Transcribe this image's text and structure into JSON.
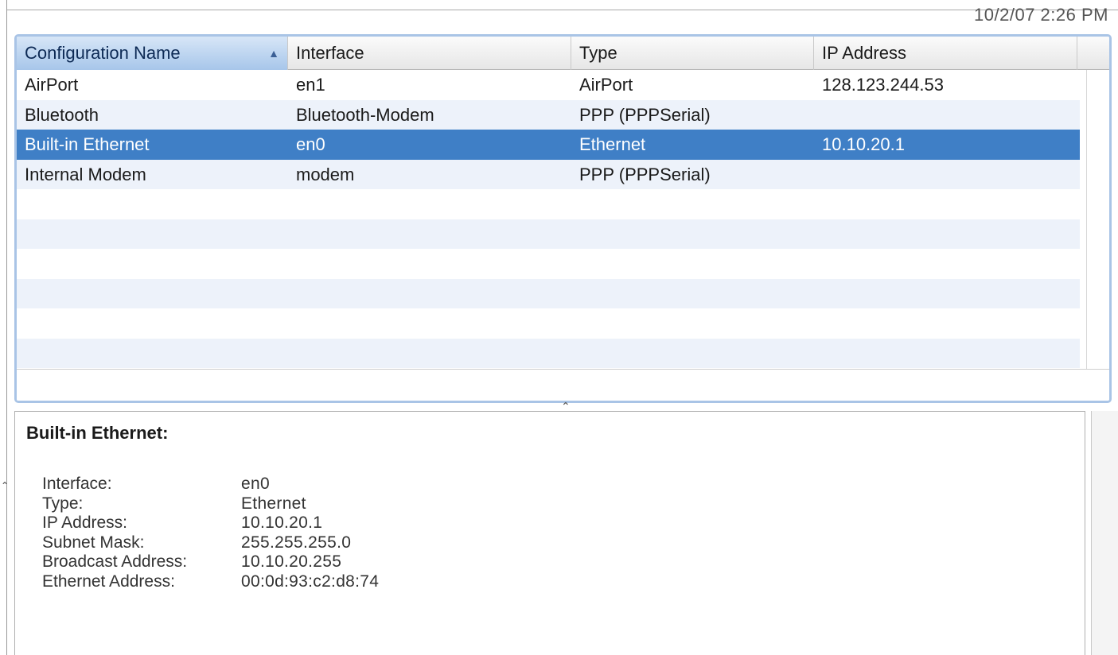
{
  "timestamp": "10/2/07 2:26 PM",
  "table": {
    "columns": [
      "Configuration Name",
      "Interface",
      "Type",
      "IP Address"
    ],
    "sort_indicator": "▲",
    "rows": [
      {
        "name": "AirPort",
        "interface": "en1",
        "type": "AirPort",
        "ip": "128.123.244.53"
      },
      {
        "name": "Bluetooth",
        "interface": "Bluetooth-Modem",
        "type": "PPP (PPPSerial)",
        "ip": ""
      },
      {
        "name": "Built-in Ethernet",
        "interface": "en0",
        "type": "Ethernet",
        "ip": "10.10.20.1",
        "selected": true
      },
      {
        "name": "Internal Modem",
        "interface": "modem",
        "type": "PPP (PPPSerial)",
        "ip": ""
      }
    ],
    "empty_rows": 6
  },
  "detail": {
    "title": "Built-in Ethernet:",
    "fields": [
      {
        "label": "Interface:",
        "value": "en0"
      },
      {
        "label": "Type:",
        "value": "Ethernet"
      },
      {
        "label": "IP Address:",
        "value": "10.10.20.1"
      },
      {
        "label": "Subnet Mask:",
        "value": "255.255.255.0"
      },
      {
        "label": "Broadcast Address:",
        "value": "10.10.20.255"
      },
      {
        "label": "Ethernet Address:",
        "value": "00:0d:93:c2:d8:74"
      }
    ]
  },
  "colors": {
    "selection": "#3f7fc6",
    "alt_row": "#edf2fa",
    "focus_ring": "#a9c4e6"
  }
}
